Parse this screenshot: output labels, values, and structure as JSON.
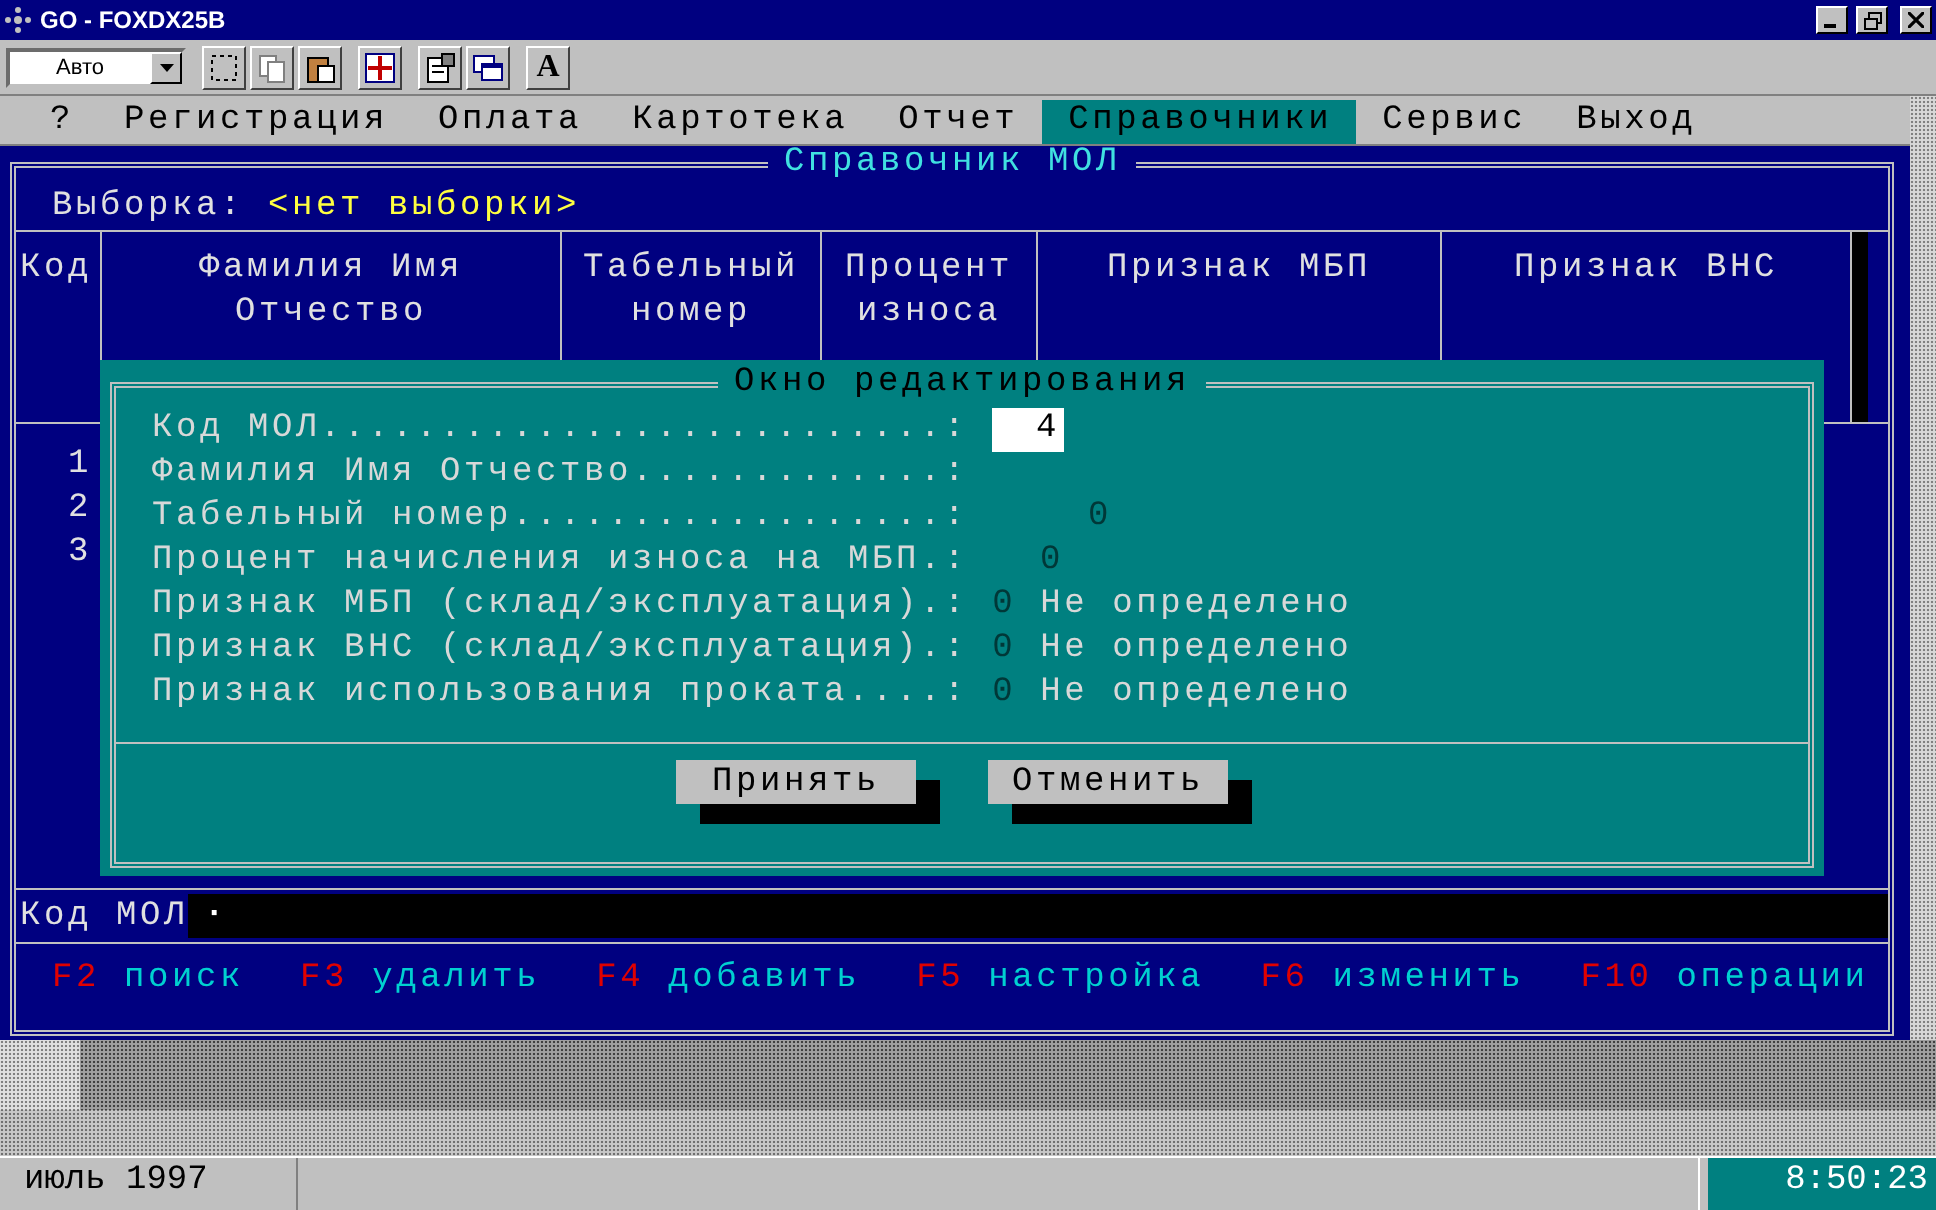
{
  "window": {
    "title": "GO - FOXDX25B"
  },
  "toolbar": {
    "font_size": "Авто",
    "font_button": "A"
  },
  "menu": [
    {
      "label": "?",
      "selected": false
    },
    {
      "label": "Регистрация",
      "selected": false
    },
    {
      "label": "Оплата",
      "selected": false
    },
    {
      "label": "Картотека",
      "selected": false
    },
    {
      "label": "Отчет",
      "selected": false
    },
    {
      "label": "Справочники",
      "selected": true
    },
    {
      "label": "Сервис",
      "selected": false
    },
    {
      "label": "Выход",
      "selected": false
    }
  ],
  "panel": {
    "title": "Справочник МОЛ",
    "filter_label": "Выборка:",
    "filter_value": "<нет выборки>"
  },
  "table": {
    "columns": [
      "Код",
      "Фамилия Имя Отчество",
      "Табельный номер",
      "Процент износа",
      "Признак МБП",
      "Признак ВНС"
    ],
    "rows": [
      {
        "code": "1"
      },
      {
        "code": "2"
      },
      {
        "code": "3"
      }
    ]
  },
  "lookup": {
    "label": "Код МОЛ",
    "value": "·"
  },
  "function_keys": [
    {
      "key": "F2",
      "action": "поиск"
    },
    {
      "key": "F3",
      "action": "удалить"
    },
    {
      "key": "F4",
      "action": "добавить"
    },
    {
      "key": "F5",
      "action": "настройка"
    },
    {
      "key": "F6",
      "action": "изменить"
    },
    {
      "key": "F10",
      "action": "операции"
    }
  ],
  "dialog": {
    "title": "Окно редактирования",
    "fields": [
      {
        "kind": "input",
        "label": "Код МОЛ..........................:",
        "value": "4"
      },
      {
        "kind": "empty",
        "label": "Фамилия Имя Отчество.............:"
      },
      {
        "kind": "number",
        "label": "Табельный номер..................:",
        "value": "0"
      },
      {
        "kind": "percent",
        "label": "Процент начисления износа на МБП.:",
        "value": "0"
      },
      {
        "kind": "flag",
        "label": "Признак МБП (склад/эксплуатация).:",
        "value": "0",
        "description": "Не определено"
      },
      {
        "kind": "flag",
        "label": "Признак ВНС (склад/эксплуатация).:",
        "value": "0",
        "description": "Не определено"
      },
      {
        "kind": "flag",
        "label": "Признак использования проката....:",
        "value": "0",
        "description": "Не определено"
      }
    ],
    "buttons": [
      "Принять",
      "Отменить"
    ]
  },
  "status_bar": {
    "date": "июль 1997",
    "time": "8:50:23"
  }
}
